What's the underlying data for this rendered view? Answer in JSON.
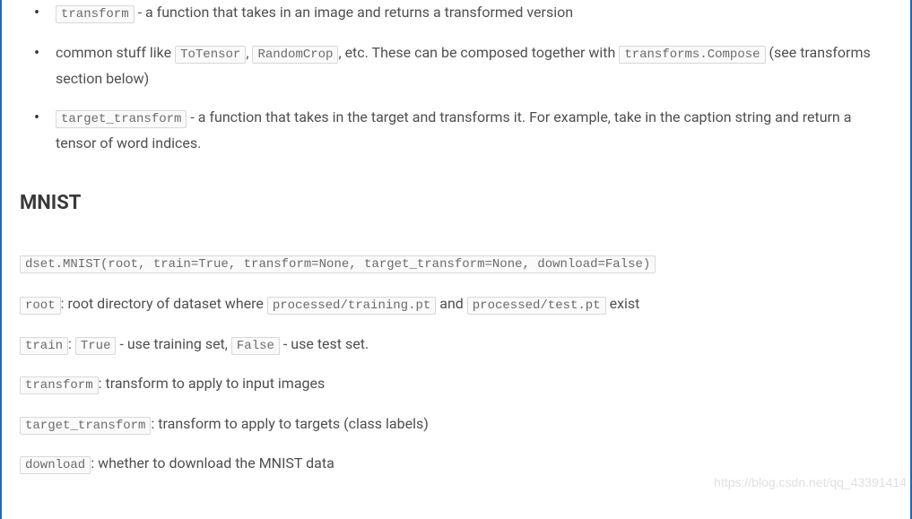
{
  "bullets": [
    {
      "code": "transform",
      "text": " - a function that takes in an image and returns a transformed version"
    },
    {
      "prefix": "common stuff like ",
      "code1": "ToTensor",
      "mid1": ", ",
      "code2": "RandomCrop",
      "mid2": ", etc. These can be composed together with ",
      "code3": "transforms.Compose",
      "suffix": " (see transforms section below)"
    },
    {
      "code": "target_transform",
      "text": " - a function that takes in the target and transforms it. For example, take in the caption string and return a tensor of word indices."
    }
  ],
  "heading": "MNIST",
  "signature": "dset.MNIST(root, train=True, transform=None, target_transform=None, download=False)",
  "params": {
    "root": {
      "name": "root",
      "pre": ": root directory of dataset where ",
      "code1": "processed/training.pt",
      "mid": " and ",
      "code2": "processed/test.pt",
      "post": " exist"
    },
    "train": {
      "name": "train",
      "pre": ": ",
      "code1": "True",
      "mid": " - use training set, ",
      "code2": "False",
      "post": " - use test set."
    },
    "transform": {
      "name": "transform",
      "text": ": transform to apply to input images"
    },
    "target_transform": {
      "name": "target_transform",
      "text": ": transform to apply to targets (class labels)"
    },
    "download": {
      "name": "download",
      "text": ": whether to download the MNIST data"
    }
  },
  "watermark": "https://blog.csdn.net/qq_43391414"
}
